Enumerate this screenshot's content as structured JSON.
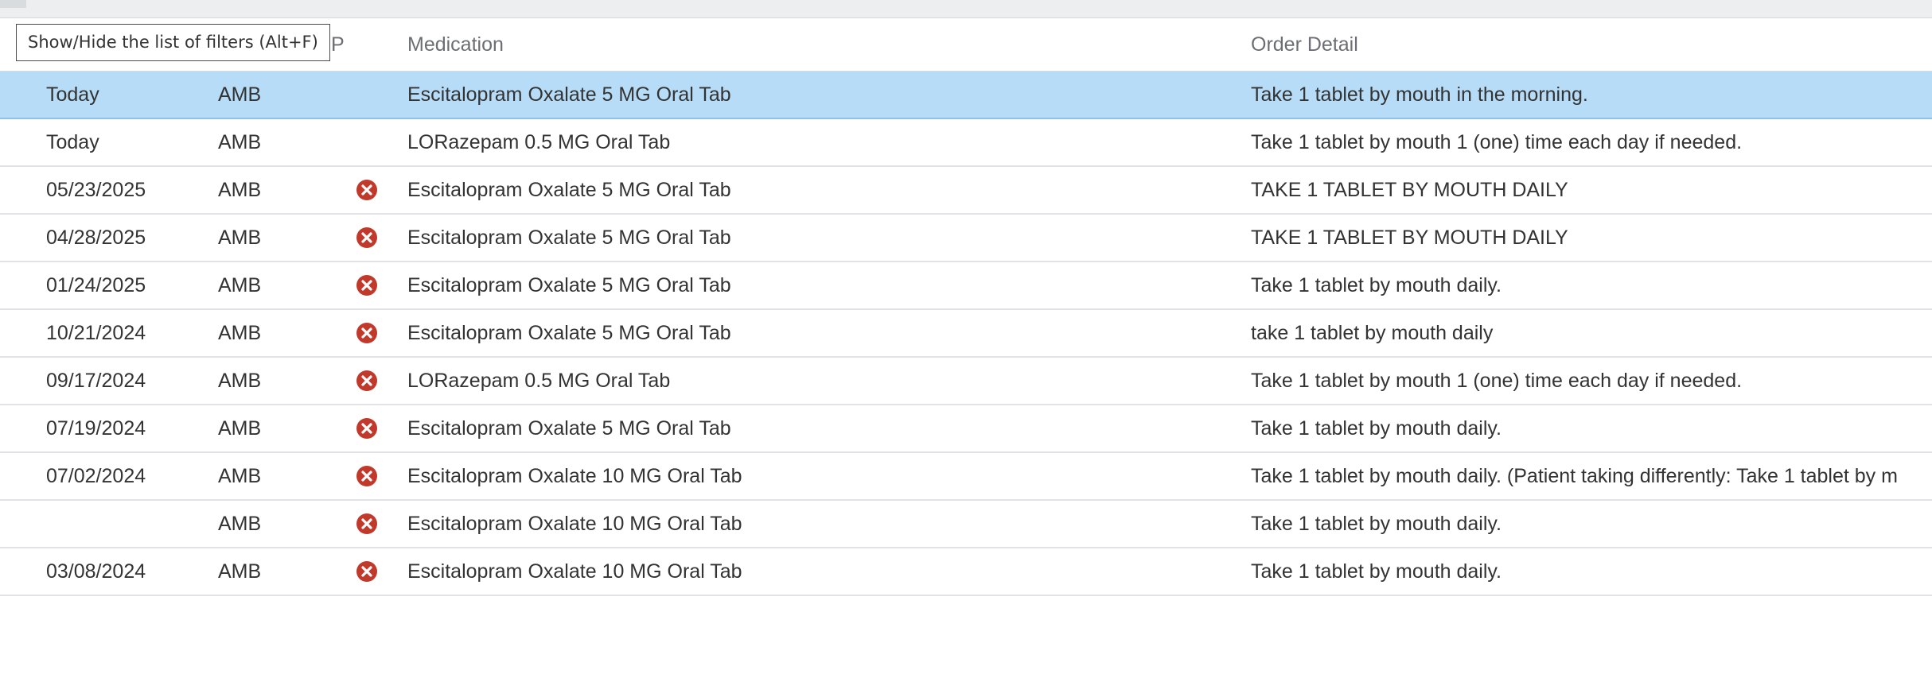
{
  "tooltip": {
    "text": "Show/Hide the list of filters (Alt+F)"
  },
  "columns": {
    "p_col": "P",
    "medication": "Medication",
    "order_detail": "Order Detail"
  },
  "colors": {
    "selected_row": "#b6dcf7",
    "discontinued_icon": "#c0392b"
  },
  "rows": [
    {
      "date": "Today",
      "type": "AMB",
      "discontinued": false,
      "medication": "Escitalopram Oxalate 5 MG Oral Tab",
      "detail": "Take 1 tablet by mouth in the morning.",
      "selected": true
    },
    {
      "date": "Today",
      "type": "AMB",
      "discontinued": false,
      "medication": "LORazepam 0.5 MG Oral Tab",
      "detail": "Take 1 tablet by mouth 1 (one) time each day if needed."
    },
    {
      "date": "05/23/2025",
      "type": "AMB",
      "discontinued": true,
      "medication": "Escitalopram Oxalate 5 MG Oral Tab",
      "detail": "TAKE 1 TABLET BY MOUTH DAILY"
    },
    {
      "date": "04/28/2025",
      "type": "AMB",
      "discontinued": true,
      "medication": "Escitalopram Oxalate 5 MG Oral Tab",
      "detail": "TAKE 1 TABLET BY MOUTH DAILY"
    },
    {
      "date": "01/24/2025",
      "type": "AMB",
      "discontinued": true,
      "medication": "Escitalopram Oxalate 5 MG Oral Tab",
      "detail": "Take 1 tablet by mouth daily."
    },
    {
      "date": "10/21/2024",
      "type": "AMB",
      "discontinued": true,
      "medication": "Escitalopram Oxalate 5 MG Oral Tab",
      "detail": "take 1 tablet by mouth daily"
    },
    {
      "date": "09/17/2024",
      "type": "AMB",
      "discontinued": true,
      "medication": "LORazepam 0.5 MG Oral Tab",
      "detail": "Take 1 tablet by mouth 1 (one) time each day if needed."
    },
    {
      "date": "07/19/2024",
      "type": "AMB",
      "discontinued": true,
      "medication": "Escitalopram Oxalate 5 MG Oral Tab",
      "detail": "Take 1 tablet by mouth daily."
    },
    {
      "date": "07/02/2024",
      "type": "AMB",
      "discontinued": true,
      "medication": "Escitalopram Oxalate 10 MG Oral Tab",
      "detail": "Take 1 tablet by mouth daily. (Patient taking differently: Take 1 tablet by m"
    },
    {
      "date": "",
      "type": "AMB",
      "discontinued": true,
      "medication": "Escitalopram Oxalate 10 MG Oral Tab",
      "detail": "Take 1 tablet by mouth daily."
    },
    {
      "date": "03/08/2024",
      "type": "AMB",
      "discontinued": true,
      "medication": "Escitalopram Oxalate 10 MG Oral Tab",
      "detail": "Take 1 tablet by mouth daily."
    }
  ]
}
